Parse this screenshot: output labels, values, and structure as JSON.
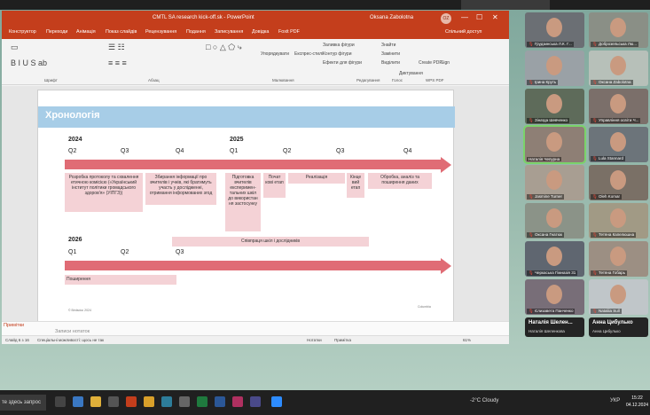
{
  "window": {
    "title": "CMTL SA research kick-off.sk - PowerPoint",
    "user": "Oksana Zabolotna",
    "avatar_initials": "OZ",
    "controls": [
      "—",
      "☐",
      "✕"
    ]
  },
  "menu": {
    "items": [
      "Конструктор",
      "Переходи",
      "Анімація",
      "Показ слайдів",
      "Рецензування",
      "Подання",
      "Записування",
      "Довідка",
      "Foxit PDF"
    ],
    "share": "Спільний доступ"
  },
  "ribbon": {
    "groups": [
      "Шрифт",
      "Абзац",
      "Малювання",
      "Редагування",
      "Голос",
      "Дизайнер",
      "WPS PDF"
    ],
    "tools": [
      "Упорядкувати",
      "Експрес-стилі",
      "Заливка фігури",
      "Контур фігури",
      "Ефекти для фігури",
      "Знайти",
      "Замінити",
      "Виділити",
      "Диктування",
      "Create PDF",
      "Sign"
    ]
  },
  "slide": {
    "title": "Хронологія",
    "timeline1": {
      "year1": "2024",
      "year2": "2025",
      "quarters": [
        "Q2",
        "Q3",
        "Q4",
        "Q1",
        "Q2",
        "Q3",
        "Q4"
      ],
      "tasks": [
        "Розробка протоколу та схвалення етичною комісією («Український інститут політики громадського здоров'я» (УІПГЗ))",
        "Збирання інформації про вчителів і учнів, які братимуть участь у дослідженні, отримання інформованих згод",
        "Підготовка вчителів експеримен- тальних шкіл до використан ня застосунку",
        "Почат кові етап",
        "Реалізація",
        "Кінце вий етап",
        "Обробка, аналіз та поширення даних"
      ]
    },
    "timeline2": {
      "year": "2026",
      "quarters": [
        "Q1",
        "Q2",
        "Q3"
      ],
      "tasks": [
        "Співпраця шкіл і дослідників",
        "Поширення"
      ]
    },
    "footer_left": "© Birdsdoc 2024",
    "footer_logo": "Columbia"
  },
  "notes_bar": {
    "label": "Примітки",
    "text": "Записи нотаток"
  },
  "status": {
    "slide_counter": "Слайд 6 з 16",
    "accessibility": "Спеціальні можливості: щось не так",
    "notes": "Нотатки",
    "display": "Примітка",
    "zoom": "61%"
  },
  "gallery": {
    "participants": [
      {
        "name": "Грудзинська Л.К. Г...",
        "mic_muted": true
      },
      {
        "name": "Доброзельська Лю...",
        "mic_muted": true
      },
      {
        "name": "Ірина Круть",
        "mic_muted": true
      },
      {
        "name": "Оксана Zabolotna",
        "mic_muted": true
      },
      {
        "name": "Зінаїда Шевченко",
        "mic_muted": true
      },
      {
        "name": "Управління освіти Ч...",
        "mic_muted": true
      },
      {
        "name": "Наталія Чепурна",
        "mic_muted": false
      },
      {
        "name": "Lula Stannard",
        "mic_muted": true
      },
      {
        "name": "Jasmine Turner",
        "mic_muted": true
      },
      {
        "name": "Oleh Komar",
        "mic_muted": true
      },
      {
        "name": "Оксана Гнатюк",
        "mic_muted": true
      },
      {
        "name": "Тетяна Капелюшна",
        "mic_muted": true
      },
      {
        "name": "Черкаська Гімназія 31",
        "mic_muted": true
      },
      {
        "name": "Тетяна Гобарь",
        "mic_muted": true
      },
      {
        "name": "Єлизавета Панченко",
        "mic_muted": true
      },
      {
        "name": "Nataliia Sull",
        "mic_muted": true
      }
    ],
    "name_tiles": [
      {
        "big": "Наталія Шелен...",
        "small": "Наталія Шеленкова"
      },
      {
        "big": "Анна Цибулько",
        "small": "Анна Цибулько"
      }
    ]
  },
  "taskbar": {
    "search": "те здесь запрос",
    "weather": "-2°C Cloudy",
    "lang": "УКР",
    "time": "15:22",
    "date": "04.12.2024"
  }
}
